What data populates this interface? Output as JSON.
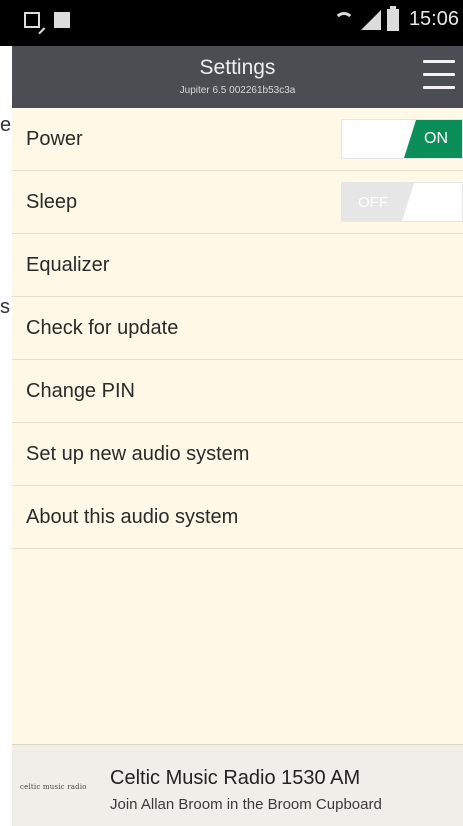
{
  "status_bar": {
    "time": "15:06",
    "icons": [
      "notification-icon",
      "image-icon",
      "wifi-icon",
      "signal-icon",
      "battery-icon"
    ]
  },
  "header": {
    "title": "Settings",
    "subtitle": "Jupiter 6.5 002261b53c3a",
    "menu_icon": "hamburger-menu-icon"
  },
  "underlay": {
    "fragments": [
      "e",
      "s"
    ]
  },
  "settings": {
    "items": [
      {
        "label": "Power",
        "toggle": "ON"
      },
      {
        "label": "Sleep",
        "toggle": "OFF"
      },
      {
        "label": "Equalizer"
      },
      {
        "label": "Check for update"
      },
      {
        "label": "Change PIN"
      },
      {
        "label": "Set up new audio system"
      },
      {
        "label": "About this audio system"
      }
    ]
  },
  "now_playing": {
    "logo_text": "celtic music radio",
    "title": "Celtic Music Radio 1530 AM",
    "subtitle": "Join Allan Broom in the Broom Cupboard"
  },
  "colors": {
    "accent_on": "#0a8f5a",
    "header_bg": "#4a4d52",
    "list_bg": "#fdf9e6"
  }
}
